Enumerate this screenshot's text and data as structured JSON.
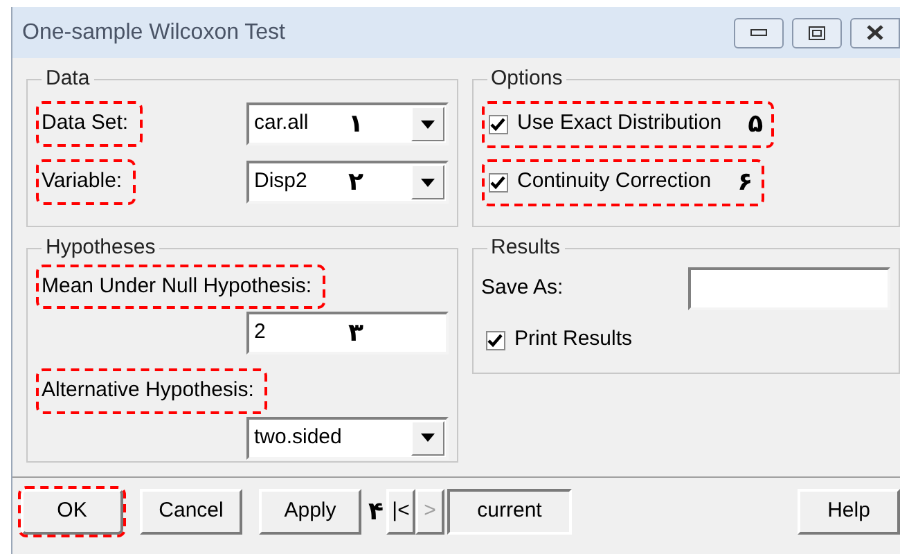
{
  "window": {
    "title": "One-sample Wilcoxon Test"
  },
  "data": {
    "title": "Data",
    "fields": [
      {
        "label": "Data Set:",
        "value": "car.all",
        "kind": "dropdown",
        "highlighted": true,
        "marker": "۱"
      },
      {
        "label": "Variable:",
        "value": "Disp2",
        "kind": "dropdown",
        "highlighted": true,
        "marker": "۲"
      }
    ]
  },
  "options": {
    "title": "Options",
    "checkboxes": [
      {
        "label": "Use Exact Distribution",
        "checked": true,
        "highlighted": true,
        "marker": "۵"
      },
      {
        "label": "Continuity Correction",
        "checked": true,
        "highlighted": true,
        "marker": "۶"
      }
    ]
  },
  "hypotheses": {
    "title": "Hypotheses",
    "fields": [
      {
        "label": "Mean Under Null Hypothesis:",
        "value": "2",
        "kind": "entry",
        "highlighted": true,
        "marker": "۳"
      },
      {
        "label": "Alternative Hypothesis:",
        "value": "two.sided",
        "kind": "dropdown",
        "highlighted": true
      }
    ]
  },
  "results": {
    "title": "Results",
    "save_as": {
      "label": "Save As:"
    },
    "checkboxes": [
      {
        "label": "Print Results",
        "checked": true,
        "highlighted": false
      }
    ]
  },
  "buttons": [
    {
      "label": "OK",
      "highlighted": true
    },
    {
      "label": "Cancel",
      "highlighted": false
    },
    {
      "label": "Apply",
      "highlighted": false
    }
  ],
  "buttons_marker": "۴",
  "nav": [
    {
      "label": "|<",
      "disabled": false
    },
    {
      "label": ">",
      "disabled": true
    }
  ],
  "page": {
    "value": "current"
  },
  "help": {
    "label": "Help"
  }
}
